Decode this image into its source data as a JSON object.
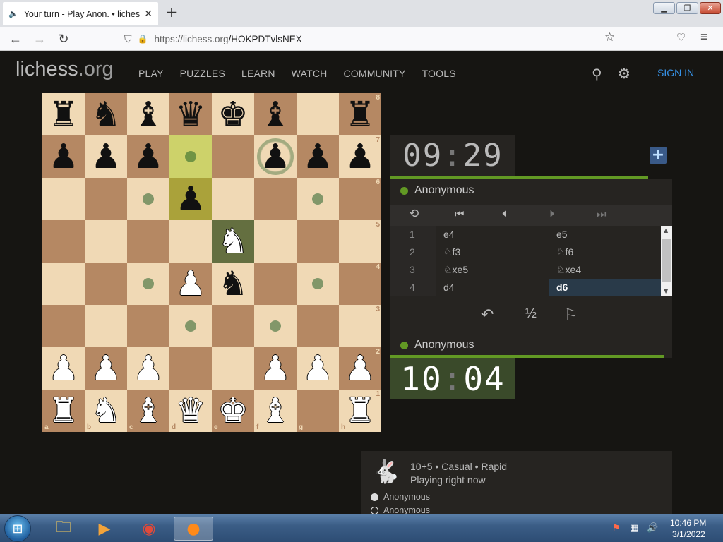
{
  "browser": {
    "tab_title": "Your turn - Play Anon. • lichess.o",
    "url_host": "https://lichess.org",
    "url_path": "/HOKPDTvlsNEX"
  },
  "site": {
    "logo_main": "lichess",
    "logo_tld": ".org",
    "nav": [
      "PLAY",
      "PUZZLES",
      "LEARN",
      "WATCH",
      "COMMUNITY",
      "TOOLS"
    ],
    "signin": "SIGN IN"
  },
  "board": {
    "pieces": [
      [
        "r",
        "n",
        "b",
        "q",
        "k",
        "b",
        "",
        "r"
      ],
      [
        "p",
        "p",
        "p",
        "",
        "",
        "p",
        "p",
        "p"
      ],
      [
        "",
        "",
        "",
        "p",
        "",
        "",
        "",
        ""
      ],
      [
        "",
        "",
        "",
        "",
        "N",
        "",
        "",
        ""
      ],
      [
        "",
        "",
        "",
        "P",
        "n",
        "",
        "",
        ""
      ],
      [
        "",
        "",
        "",
        "",
        "",
        "",
        "",
        ""
      ],
      [
        "P",
        "P",
        "P",
        "",
        "",
        "P",
        "P",
        "P"
      ],
      [
        "R",
        "N",
        "B",
        "Q",
        "K",
        "B",
        "",
        "R"
      ]
    ],
    "last_move": [
      "d7",
      "d6"
    ],
    "selected": "e5",
    "destinations": [
      "d7",
      "c6",
      "g6",
      "c4",
      "g4",
      "d3",
      "f3",
      "f7"
    ],
    "rank_labels": [
      "8",
      "7",
      "6",
      "5",
      "4",
      "3",
      "2",
      "1"
    ],
    "file_labels": [
      "a",
      "b",
      "c",
      "d",
      "e",
      "f",
      "g",
      "h"
    ]
  },
  "clocks": {
    "opponent": {
      "mm": "09",
      "ss": "29"
    },
    "player": {
      "mm": "10",
      "ss": "04"
    }
  },
  "players": {
    "top": "Anonymous",
    "bottom": "Anonymous"
  },
  "moves": [
    {
      "n": "1",
      "w": "e4",
      "b": "e5"
    },
    {
      "n": "2",
      "w": "♘f3",
      "b": "♘f6"
    },
    {
      "n": "3",
      "w": "♘xe5",
      "b": "♘xe4"
    },
    {
      "n": "4",
      "w": "d4",
      "b": "d6"
    }
  ],
  "actions": {
    "draw_label": "½"
  },
  "game_info": {
    "type": "10+5 • Casual • Rapid",
    "status": "Playing right now",
    "white": "Anonymous",
    "black": "Anonymous"
  },
  "taskbar": {
    "time": "10:46 PM",
    "date": "3/1/2022"
  },
  "colors": {
    "accent_green": "#629924",
    "signin_blue": "#3692e7",
    "board_light": "#f0d9b5",
    "board_dark": "#b58863",
    "move_highlight": "#293a49"
  }
}
